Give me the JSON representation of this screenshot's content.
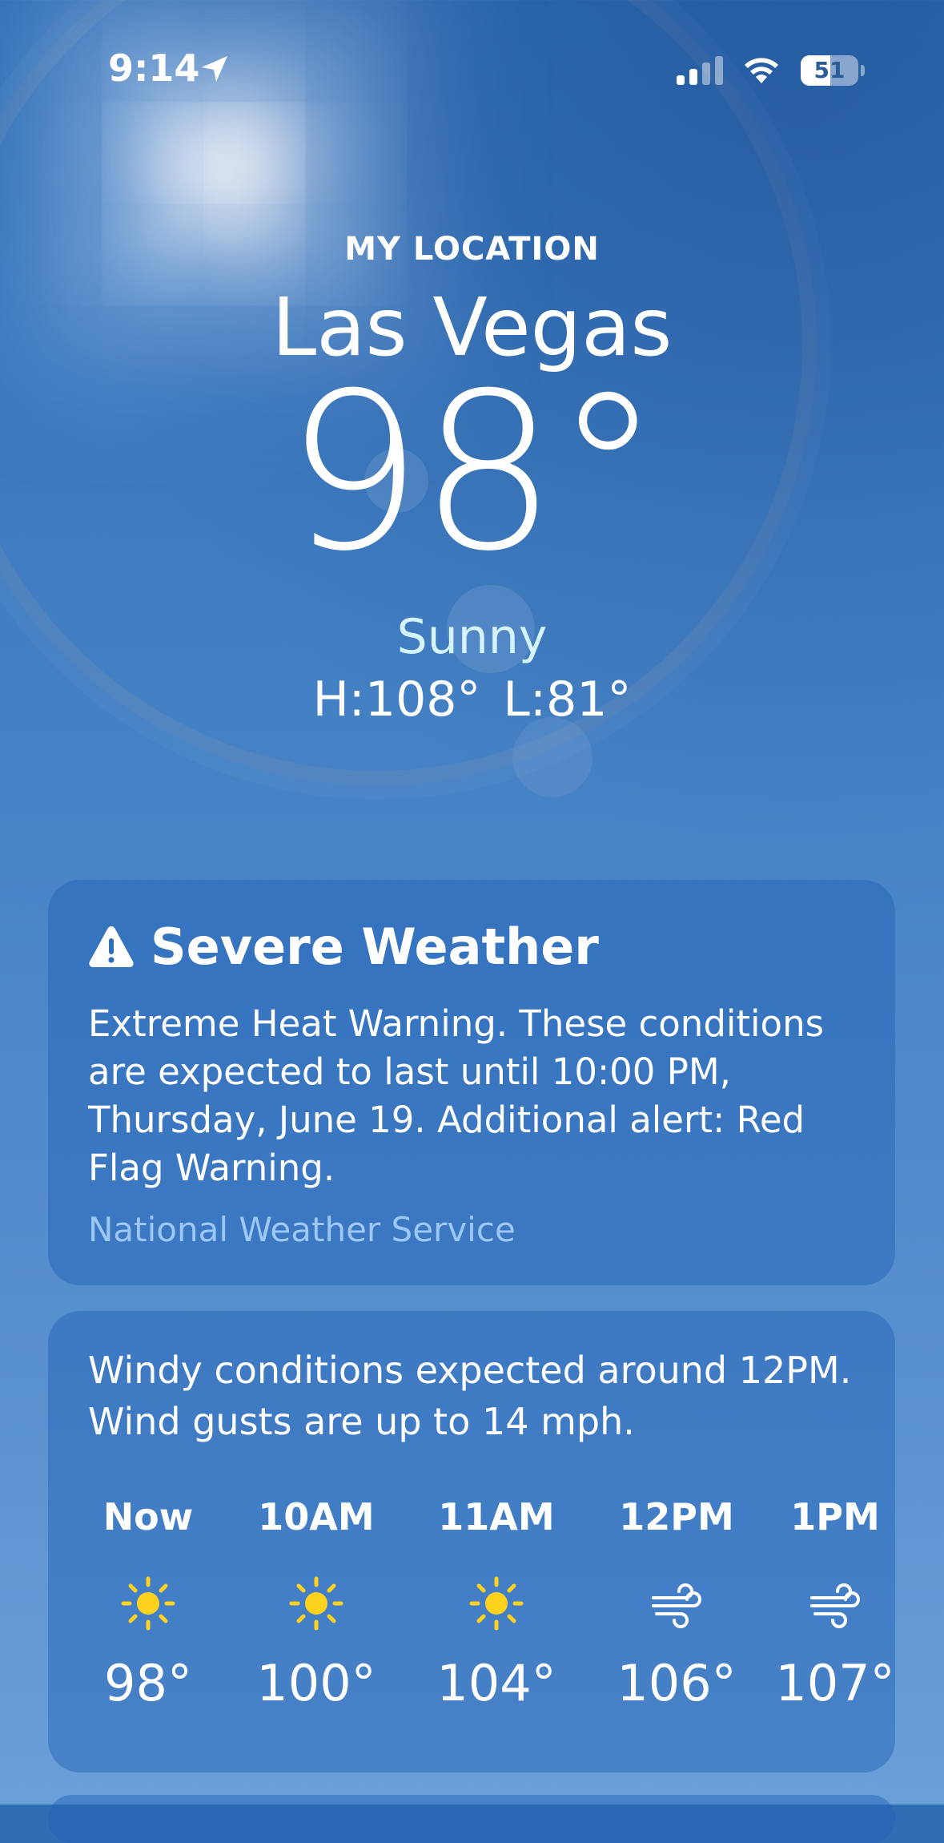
{
  "status_bar": {
    "time": "9:14",
    "battery": "51",
    "battery_level": 0.51,
    "icons": [
      "location-arrow-icon",
      "cellular-signal-icon",
      "wifi-icon",
      "battery-icon"
    ]
  },
  "header": {
    "location_label": "MY LOCATION",
    "city": "Las Vegas",
    "temperature": "98°",
    "condition": "Sunny",
    "high": "H:108°",
    "low": "L:81°"
  },
  "alert_card": {
    "icon": "warning-icon",
    "title": "Severe Weather",
    "body": "Extreme Heat Warning. These conditions are expected to last until 10:00 PM, Thursday, June 19. Additional alert: Red Flag Warning.",
    "source": "National Weather Service"
  },
  "hourly_card": {
    "summary": "Windy conditions expected around 12PM. Wind gusts are up to 14 mph.",
    "hours": [
      {
        "label": "Now",
        "icon": "sun-icon",
        "temp": "98°"
      },
      {
        "label": "10AM",
        "icon": "sun-icon",
        "temp": "100°"
      },
      {
        "label": "11AM",
        "icon": "sun-icon",
        "temp": "104°"
      },
      {
        "label": "12PM",
        "icon": "wind-icon",
        "temp": "106°"
      },
      {
        "label": "1PM",
        "icon": "wind-icon",
        "temp": "107°"
      }
    ]
  },
  "colors": {
    "sky_top": "#2e6db3",
    "sky_bottom": "#6aa0da",
    "condition_text": "#d4f4ff",
    "source_link": "#9cc8f7",
    "sun_yellow": "#ffd21f"
  }
}
